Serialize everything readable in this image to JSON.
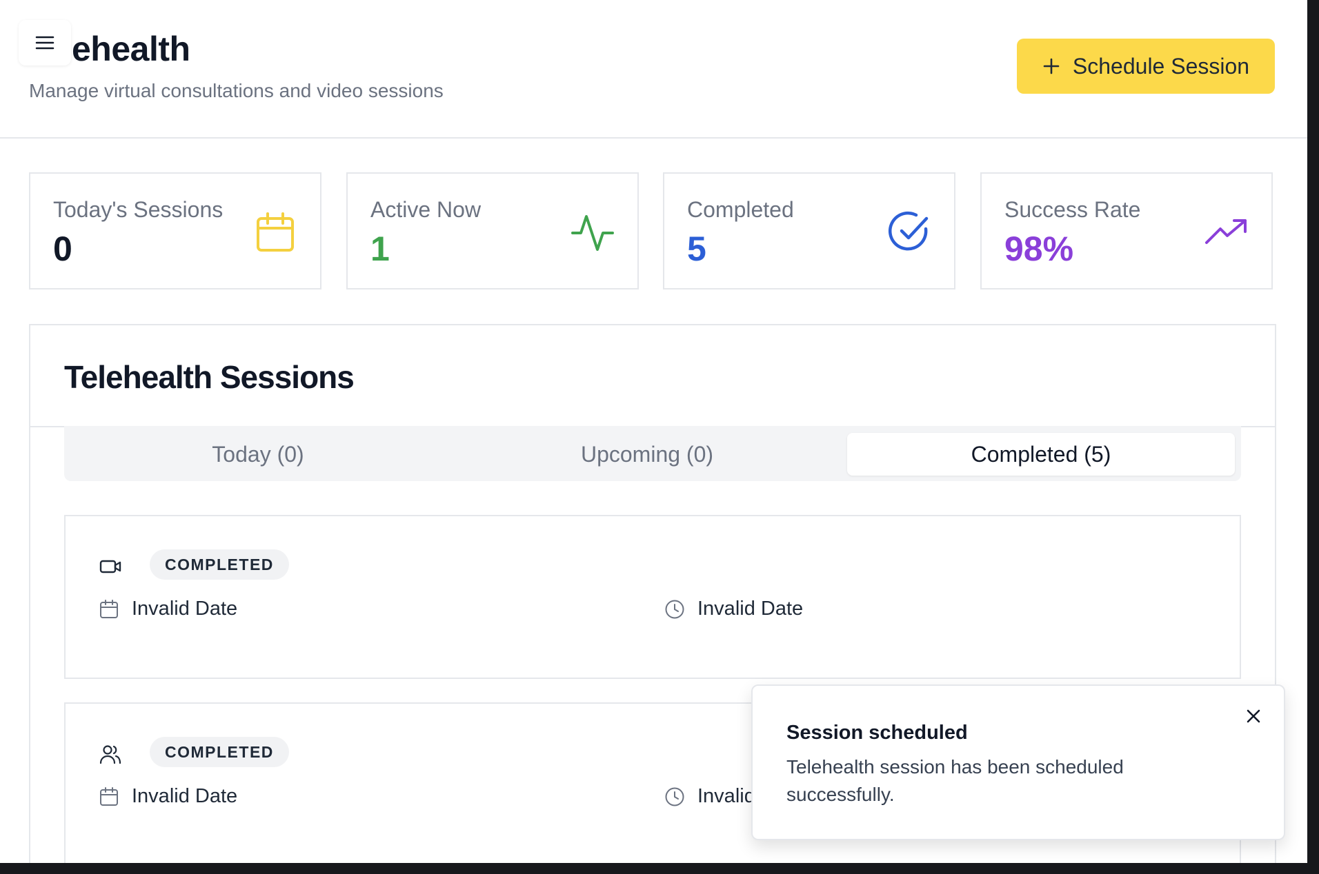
{
  "header": {
    "title": "ehealth",
    "subtitle": "Manage virtual consultations and video sessions",
    "menu_icon": "hamburger-icon",
    "schedule_button": {
      "icon": "plus-icon",
      "label": "Schedule Session",
      "color": "#fcd94a"
    }
  },
  "stats": [
    {
      "label": "Today's Sessions",
      "value": "0",
      "icon": "calendar-icon",
      "color": "#111827",
      "icon_color": "#f4d03f"
    },
    {
      "label": "Active Now",
      "value": "1",
      "icon": "activity-icon",
      "color": "#3fa34d",
      "icon_color": "#3fa34d"
    },
    {
      "label": "Completed",
      "value": "5",
      "icon": "check-circle-icon",
      "color": "#2c5fd6",
      "icon_color": "#2c5fd6"
    },
    {
      "label": "Success Rate",
      "value": "98%",
      "icon": "trending-up-icon",
      "color": "#8a3fd9",
      "icon_color": "#8a3fd9"
    }
  ],
  "sessions_panel": {
    "title": "Telehealth Sessions",
    "tabs": [
      {
        "label": "Today (0)",
        "active": false
      },
      {
        "label": "Upcoming (0)",
        "active": false
      },
      {
        "label": "Completed (5)",
        "active": true
      }
    ],
    "sessions": [
      {
        "type_icon": "video-icon",
        "status": "COMPLETED",
        "date": "Invalid Date",
        "time": "Invalid Date"
      },
      {
        "type_icon": "users-icon",
        "status": "COMPLETED",
        "date": "Invalid Date",
        "time": "Invalid"
      }
    ]
  },
  "toast": {
    "title": "Session scheduled",
    "description": "Telehealth session has been scheduled successfully.",
    "close_icon": "close-icon"
  }
}
